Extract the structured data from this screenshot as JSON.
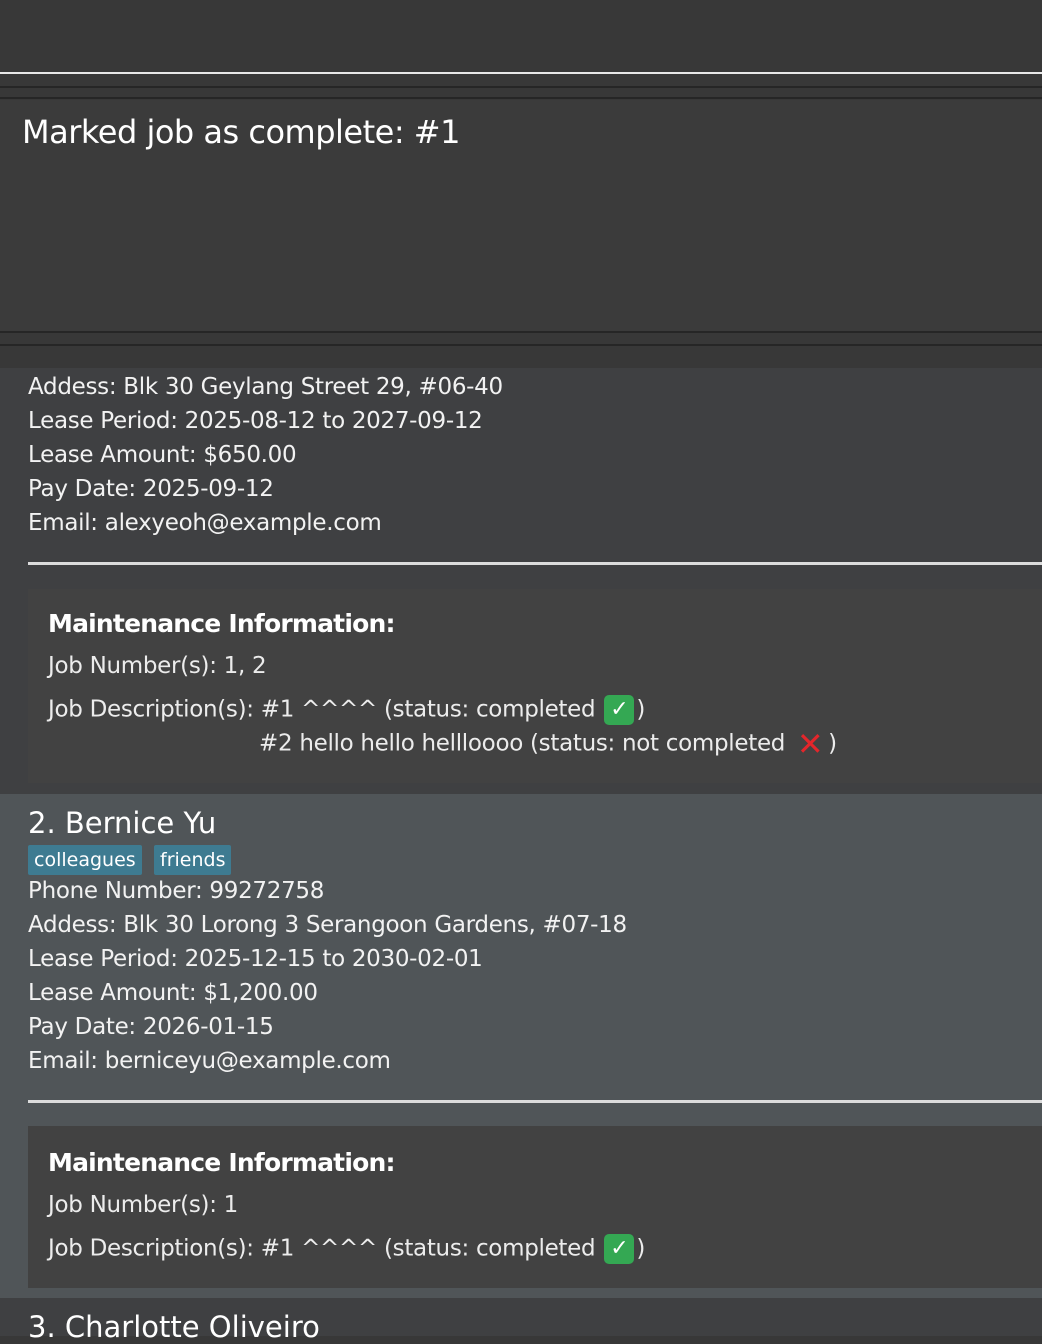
{
  "command_box": {
    "value": ""
  },
  "result": {
    "message": "Marked job as complete: #1"
  },
  "persons": [
    {
      "address": "Addess:  Blk 30 Geylang Street 29, #06-40",
      "lease_period": "Lease Period: 2025-08-12 to 2027-09-12",
      "lease_amount": "Lease Amount: $650.00",
      "pay_date": "Pay Date: 2025-09-12",
      "email": "Email: alexyeoh@example.com",
      "maintenance": {
        "title": "Maintenance Information:",
        "job_numbers": "Job Number(s): 1, 2",
        "jobs": [
          {
            "prefix": "Job Description(s): #1 ^^^^ (status: completed",
            "status_icon": "check-icon",
            "suffix": ")"
          },
          {
            "prefix": "#2 hello hello hellloooo (status: not completed",
            "status_icon": "cross-icon",
            "suffix": ")"
          }
        ]
      }
    },
    {
      "name": "2. Bernice Yu",
      "tags": [
        "colleagues",
        "friends"
      ],
      "phone": "Phone Number:  99272758",
      "address": "Addess:  Blk 30 Lorong 3 Serangoon Gardens, #07-18",
      "lease_period": "Lease Period: 2025-12-15 to 2030-02-01",
      "lease_amount": "Lease Amount: $1,200.00",
      "pay_date": "Pay Date: 2026-01-15",
      "email": "Email: berniceyu@example.com",
      "maintenance": {
        "title": "Maintenance Information:",
        "job_numbers": "Job Number(s): 1",
        "jobs": [
          {
            "prefix": "Job Description(s): #1 ^^^^ (status: completed",
            "status_icon": "check-icon",
            "suffix": ")"
          }
        ]
      }
    },
    {
      "name": "3. Charlotte Oliveiro"
    }
  ],
  "colors": {
    "background": "#383838",
    "card_alt": "#505558",
    "tag": "#3e7b91",
    "completed": "#34a853",
    "not_completed": "#e3262b"
  }
}
